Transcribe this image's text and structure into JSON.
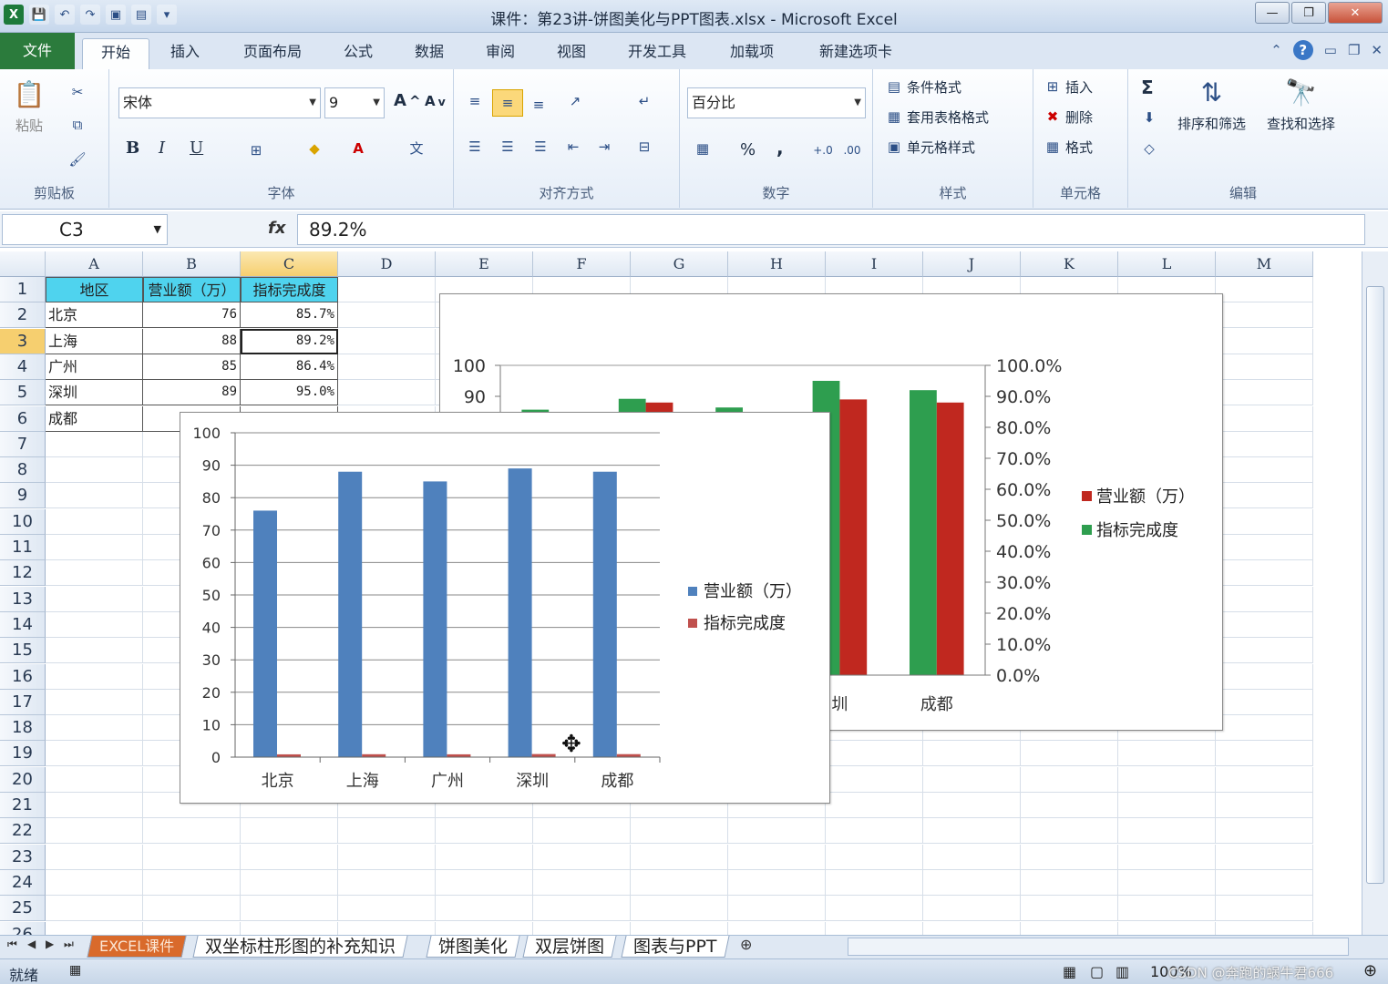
{
  "window": {
    "title": "课件：第23讲-饼图美化与PPT图表.xlsx  -  Microsoft Excel",
    "logo": "X"
  },
  "tabs": {
    "file": "文件",
    "items": [
      "开始",
      "插入",
      "页面布局",
      "公式",
      "数据",
      "审阅",
      "视图",
      "开发工具",
      "加载项",
      "新建选项卡"
    ],
    "active_index": 0
  },
  "ribbon": {
    "clipboard": {
      "label": "剪贴板",
      "paste": "粘贴"
    },
    "font": {
      "label": "字体",
      "name": "宋体",
      "size": "9",
      "bold": "B",
      "italic": "I",
      "underline": "U"
    },
    "alignment": {
      "label": "对齐方式"
    },
    "number": {
      "label": "数字",
      "format": "百分比",
      "percent": "%",
      "comma": ",",
      "inc_decimal": "+.0\n.00",
      "dec_decimal": ".00\n+.0"
    },
    "styles": {
      "label": "样式",
      "conditional": "条件格式",
      "table": "套用表格格式",
      "cell": "单元格样式"
    },
    "cells": {
      "label": "单元格",
      "insert": "插入",
      "delete": "删除",
      "format": "格式"
    },
    "editing": {
      "label": "编辑",
      "sum": "Σ",
      "sort": "排序和筛选",
      "find": "查找和选择"
    }
  },
  "formula_bar": {
    "name_box": "C3",
    "fx": "fx",
    "value": "89.2%"
  },
  "columns": [
    "A",
    "B",
    "C",
    "D",
    "E",
    "F",
    "G",
    "H",
    "I",
    "J",
    "K",
    "L",
    "M"
  ],
  "rows": [
    "1",
    "2",
    "3",
    "4",
    "5",
    "6",
    "7",
    "8",
    "9",
    "10",
    "11",
    "12",
    "13",
    "14",
    "15",
    "16",
    "17",
    "18",
    "19",
    "20",
    "21",
    "22",
    "23",
    "24",
    "25",
    "26"
  ],
  "sheet": {
    "headers": [
      "地区",
      "营业额（万）",
      "指标完成度"
    ],
    "data": [
      [
        "北京",
        "76",
        "85.7%"
      ],
      [
        "上海",
        "88",
        "89.2%"
      ],
      [
        "广州",
        "85",
        "86.4%"
      ],
      [
        "深圳",
        "89",
        "95.0%"
      ],
      [
        "成都",
        "",
        ""
      ]
    ]
  },
  "chart_data": [
    {
      "type": "bar",
      "categories": [
        "北京",
        "上海",
        "广州",
        "深圳",
        "成都"
      ],
      "series": [
        {
          "name": "营业额（万）",
          "values": [
            76,
            88,
            85,
            89,
            88
          ],
          "color": "#c0281f",
          "axis": "left"
        },
        {
          "name": "指标完成度",
          "values": [
            0.857,
            0.892,
            0.864,
            0.95,
            0.92
          ],
          "color": "#2e9e4f",
          "axis": "right"
        }
      ],
      "left_axis": {
        "ylim": [
          0,
          100
        ],
        "visible_ticks": [
          "100",
          "90"
        ]
      },
      "right_axis": {
        "ylim": [
          0,
          1
        ],
        "ticks": [
          "100.0%",
          "90.0%",
          "80.0%",
          "70.0%",
          "60.0%",
          "50.0%",
          "40.0%",
          "30.0%",
          "20.0%",
          "10.0%",
          "0.0%"
        ]
      },
      "visible_categories": [
        "圳",
        "成都"
      ],
      "legend": "right"
    },
    {
      "type": "bar",
      "categories": [
        "北京",
        "上海",
        "广州",
        "深圳",
        "成都"
      ],
      "series": [
        {
          "name": "营业额（万）",
          "values": [
            76,
            88,
            85,
            89,
            88
          ],
          "color": "#4f81bd"
        },
        {
          "name": "指标完成度",
          "values": [
            0.857,
            0.892,
            0.864,
            0.95,
            0.92
          ],
          "color": "#c0504d"
        }
      ],
      "ylim": [
        0,
        100
      ],
      "yticks": [
        "100",
        "90",
        "80",
        "70",
        "60",
        "50",
        "40",
        "30",
        "20",
        "10",
        "0"
      ],
      "legend": "right"
    }
  ],
  "sheet_tabs": [
    "EXCEL课件",
    "双坐标柱形图的补充知识",
    "饼图美化",
    "双层饼图",
    "图表与PPT"
  ],
  "status": {
    "ready": "就绪",
    "zoom": "100%",
    "watermark": "CSDN @奔跑的蜗牛君666"
  }
}
